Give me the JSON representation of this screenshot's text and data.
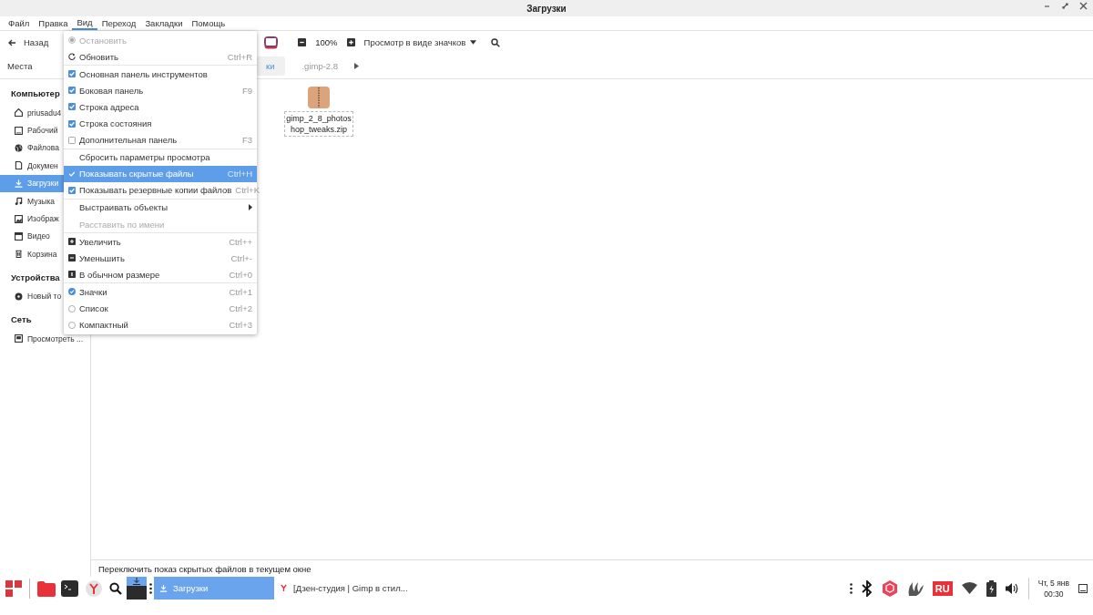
{
  "window": {
    "title": "Загрузки"
  },
  "menubar": [
    {
      "label": "Файл",
      "selected": false
    },
    {
      "label": "Правка",
      "selected": false
    },
    {
      "label": "Вид",
      "selected": true
    },
    {
      "label": "Переход",
      "selected": false
    },
    {
      "label": "Закладки",
      "selected": false
    },
    {
      "label": "Помощь",
      "selected": false
    }
  ],
  "toolbar": {
    "back": "Назад",
    "zoom": "100%",
    "view_mode": "Просмотр в виде значков"
  },
  "places": {
    "label": "Места"
  },
  "pathbar": [
    {
      "label": "ки",
      "selected": true
    },
    {
      "label": ".gimp-2.8",
      "selected": false
    }
  ],
  "sidebar": [
    {
      "title": "Компьютер",
      "items": [
        {
          "label": "priusadu4",
          "selected": false
        },
        {
          "label": "Рабочий",
          "selected": false
        },
        {
          "label": "Файлова",
          "selected": false
        },
        {
          "label": "Докумен",
          "selected": false
        },
        {
          "label": "Загрузки",
          "selected": true
        },
        {
          "label": "Музыка",
          "selected": false
        },
        {
          "label": "Изображ",
          "selected": false
        },
        {
          "label": "Видео",
          "selected": false
        },
        {
          "label": "Корзина",
          "selected": false
        }
      ]
    },
    {
      "title": "Устройства",
      "items": [
        {
          "label": "Новый то",
          "selected": false
        }
      ]
    },
    {
      "title": "Сеть",
      "items": [
        {
          "label": "Просмотреть ...",
          "selected": false
        }
      ]
    }
  ],
  "files": [
    {
      "name": "gimp_2_8_photoshop_tweaks.zip",
      "kind": "archive"
    }
  ],
  "menu": {
    "groups": [
      [
        {
          "kind": "stop",
          "label": "Остановить",
          "disabled": true,
          "selected": false
        },
        {
          "kind": "reload",
          "label": "Обновить",
          "shortcut": "Ctrl+R",
          "disabled": false,
          "selected": false
        }
      ],
      [
        {
          "kind": "check",
          "label": "Основная панель инструментов",
          "checked": true,
          "disabled": false,
          "selected": false
        },
        {
          "kind": "check",
          "label": "Боковая панель",
          "shortcut": "F9",
          "checked": true,
          "disabled": false,
          "selected": false
        },
        {
          "kind": "check",
          "label": "Строка адреса",
          "checked": true,
          "disabled": false,
          "selected": false
        },
        {
          "kind": "check",
          "label": "Строка состояния",
          "checked": true,
          "disabled": false,
          "selected": false
        },
        {
          "kind": "check",
          "label": "Дополнительная панель",
          "shortcut": "F3",
          "checked": false,
          "disabled": false,
          "selected": false
        }
      ],
      [
        {
          "kind": "plain",
          "label": "Сбросить параметры просмотра",
          "disabled": false,
          "selected": false
        },
        {
          "kind": "check",
          "label": "Показывать скрытые файлы",
          "shortcut": "Ctrl+H",
          "checked": true,
          "disabled": false,
          "selected": true
        },
        {
          "kind": "check",
          "label": "Показывать резервные копии файлов",
          "shortcut": "Ctrl+K",
          "checked": true,
          "disabled": false,
          "selected": false
        }
      ],
      [
        {
          "kind": "submenu",
          "label": "Выстраивать объекты",
          "disabled": false,
          "selected": false
        },
        {
          "kind": "plain",
          "label": "Расставить по имени",
          "disabled": true,
          "selected": false
        }
      ],
      [
        {
          "kind": "zoom-in",
          "label": "Увеличить",
          "shortcut": "Ctrl++",
          "disabled": false,
          "selected": false
        },
        {
          "kind": "zoom-out",
          "label": "Уменьшить",
          "shortcut": "Ctrl+-",
          "disabled": false,
          "selected": false
        },
        {
          "kind": "zoom-normal",
          "label": "В обычном размере",
          "shortcut": "Ctrl+0",
          "disabled": false,
          "selected": false
        }
      ],
      [
        {
          "kind": "radio",
          "label": "Значки",
          "shortcut": "Ctrl+1",
          "checked": true,
          "disabled": false,
          "selected": false
        },
        {
          "kind": "radio",
          "label": "Список",
          "shortcut": "Ctrl+2",
          "checked": false,
          "disabled": false,
          "selected": false
        },
        {
          "kind": "radio",
          "label": "Компактный",
          "shortcut": "Ctrl+3",
          "checked": false,
          "disabled": false,
          "selected": false
        }
      ]
    ]
  },
  "status_bar": "Переключить показ скрытых файлов в текущем окне",
  "taskbar": {
    "tasks": [
      {
        "label": "Загрузки",
        "selected": true
      },
      {
        "label": "[Дзен-студия | Gimp в стил...",
        "selected": false
      }
    ],
    "keyboard_layout": "RU",
    "clock_day": "Чт, 5 янв",
    "clock_time": "00:30"
  }
}
